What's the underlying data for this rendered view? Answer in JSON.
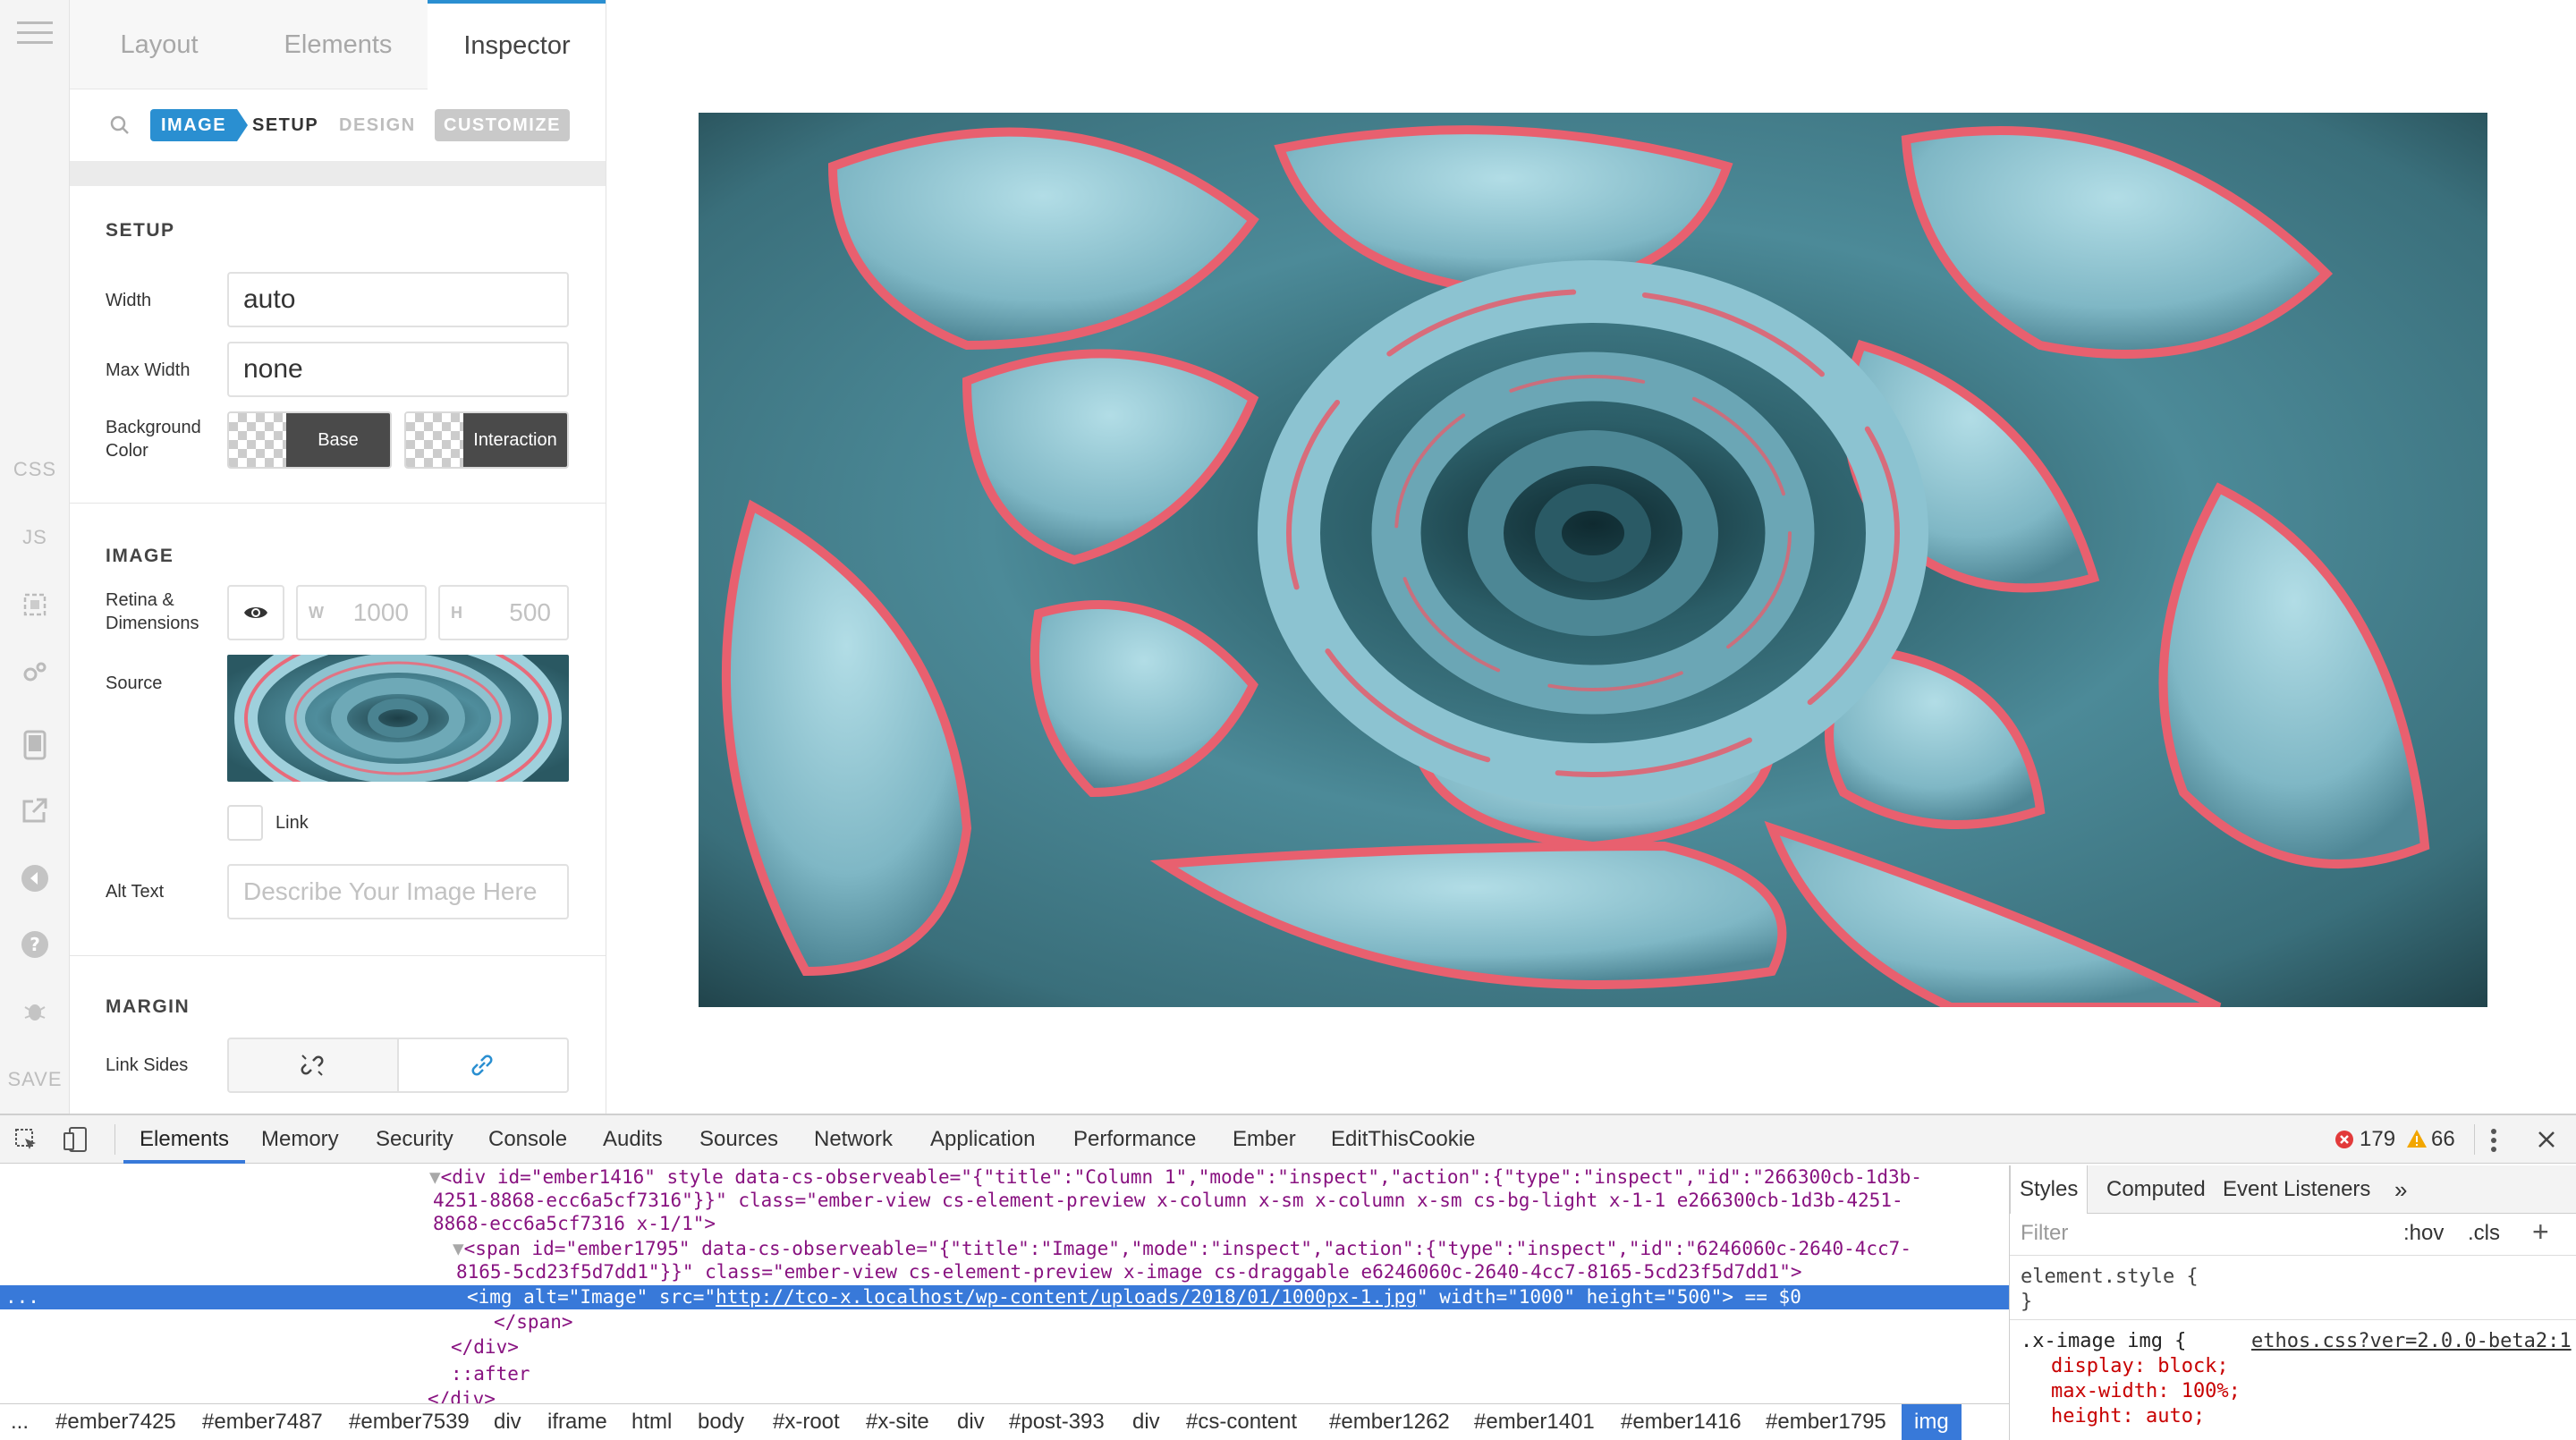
{
  "rail": {
    "css_label": "CSS",
    "js_label": "JS",
    "save_label": "SAVE"
  },
  "panel": {
    "tabs": [
      "Layout",
      "Elements",
      "Inspector"
    ],
    "subtabs": {
      "image": "IMAGE",
      "setup": "SETUP",
      "design": "DESIGN",
      "customize": "CUSTOMIZE"
    },
    "setup": {
      "title": "SETUP",
      "width_label": "Width",
      "width_value": "auto",
      "maxwidth_label": "Max Width",
      "maxwidth_value": "none",
      "bg_label_1": "Background",
      "bg_label_2": "Color",
      "base_label": "Base",
      "interaction_label": "Interaction"
    },
    "image": {
      "title": "IMAGE",
      "retina_label_1": "Retina &",
      "retina_label_2": "Dimensions",
      "w_prefix": "W",
      "w_value": "1000",
      "h_prefix": "H",
      "h_value": "500",
      "source_label": "Source",
      "link_label": "Link",
      "alt_label": "Alt Text",
      "alt_placeholder": "Describe Your Image Here"
    },
    "margin": {
      "title": "MARGIN",
      "link_sides_label": "Link Sides"
    }
  },
  "devtools": {
    "tabs": [
      "Elements",
      "Memory",
      "Security",
      "Console",
      "Audits",
      "Sources",
      "Network",
      "Application",
      "Performance",
      "Ember",
      "EditThisCookie"
    ],
    "errors": "179",
    "warnings": "66",
    "dom": {
      "l1a": "<div id=\"ember1416\" style data-cs-observeable=\"{\"title\":\"Column 1\",\"mode\":\"inspect\",\"action\":{\"type\":\"inspect\",\"id\":\"266300cb-1d3b-",
      "l1b": "4251-8868-ecc6a5cf7316\"}}\" class=\"ember-view cs-element-preview x-column x-sm x-column x-sm cs-bg-light x-1-1 e266300cb-1d3b-4251-",
      "l1c": "8868-ecc6a5cf7316 x-1/1\">",
      "l2a": "<span id=\"ember1795\" data-cs-observeable=\"{\"title\":\"Image\",\"mode\":\"inspect\",\"action\":{\"type\":\"inspect\",\"id\":\"6246060c-2640-4cc7-",
      "l2b": "8165-5cd23f5d7dd1\"}}\" class=\"ember-view cs-element-preview x-image cs-draggable e6246060c-2640-4cc7-8165-5cd23f5d7dd1\">",
      "sel_tag": "<img alt=\"Image\" src=\"",
      "sel_url": "http://tco-x.localhost/wp-content/uploads/2018/01/1000px-1.jpg",
      "sel_rest": "\" width=\"1000\" height=\"500\"> == $0",
      "close_span": "</span>",
      "close_div": "</div>",
      "after": "::after",
      "close_div2": "</div>"
    },
    "breadcrumbs": [
      "#ember7425",
      "#ember7487",
      "#ember7539",
      "div",
      "iframe",
      "html",
      "body",
      "#x-root",
      "#x-site",
      "div",
      "#post-393",
      "div",
      "#cs-content",
      "#ember1262",
      "#ember1401",
      "#ember1416",
      "#ember1795",
      "img"
    ],
    "breadcrumb_more": "...",
    "styles": {
      "tabs": [
        "Styles",
        "Computed",
        "Event Listeners"
      ],
      "filter_placeholder": "Filter",
      "hov": ":hov",
      "cls": ".cls",
      "element_style": "element.style {",
      "close_brace": "}",
      "selector": ".x-image img {",
      "source_link": "ethos.css?ver=2.0.0-beta2:1",
      "rules": [
        "display: block;",
        "max-width: 100%;",
        "height: auto;"
      ]
    }
  },
  "colors": {
    "accent": "#2a8fd1",
    "devtools_accent": "#3879d9",
    "error": "#e23a3a",
    "warning": "#f2a600"
  }
}
